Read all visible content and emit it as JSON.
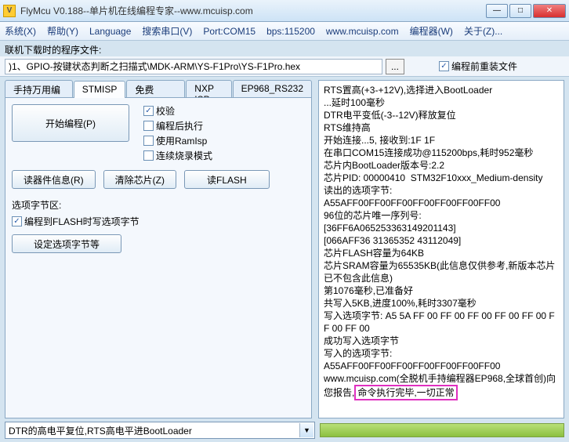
{
  "window": {
    "icon_letter": "V",
    "title": "FlyMcu V0.188--单片机在线编程专家--www.mcuisp.com"
  },
  "menu": {
    "system": "系统(X)",
    "help": "帮助(Y)",
    "language": "Language",
    "search_port": "搜索串口(V)",
    "port": "Port:COM15",
    "bps": "bps:115200",
    "site": "www.mcuisp.com",
    "programmer": "编程器(W)",
    "about": "关于(Z)..."
  },
  "toolbar": {
    "label": "联机下载时的程序文件:",
    "path": ")1、GPIO-按键状态判断之扫描式\\MDK-ARM\\YS-F1Pro\\YS-F1Pro.hex",
    "browse": "...",
    "reinstall_label": "编程前重装文件"
  },
  "tabs": {
    "t1": "手持万用编程器",
    "t2": "STMISP",
    "t3": "免费STMIAP",
    "t4": "NXP ISP",
    "t5": "EP968_RS232"
  },
  "left": {
    "start_prog": "开始编程(P)",
    "opt_verify": "校验",
    "opt_runafter": "编程后执行",
    "opt_ramisp": "使用RamIsp",
    "opt_continuous": "连续烧录模式",
    "btn_readinfo": "读器件信息(R)",
    "btn_clearchip": "清除芯片(Z)",
    "btn_readflash": "读FLASH",
    "section_label": "选项字节区:",
    "opt_writeoption": "编程到FLASH时写选项字节",
    "btn_setoption": "设定选项字节等"
  },
  "log_lines": [
    "RTS置高(+3-+12V),选择进入BootLoader",
    "...延时100毫秒",
    "DTR电平变低(-3--12V)释放复位",
    "RTS维持高",
    "开始连接...5, 接收到:1F 1F",
    "在串口COM15连接成功@115200bps,耗时952毫秒",
    "芯片内BootLoader版本号:2.2",
    "芯片PID: 00000410  STM32F10xxx_Medium-density",
    "读出的选项字节:",
    "A55AFF00FF00FF00FF00FF00FF00FF00",
    "96位的芯片唯一序列号:",
    "[36FF6A065253363149201143]",
    "[066AFF36 31365352 43112049]",
    "芯片FLASH容量为64KB",
    "芯片SRAM容量为65535KB(此信息仅供参考,新版本芯片已不包含此信息)",
    "第1076毫秒,已准备好",
    "共写入5KB,进度100%,耗时3307毫秒",
    "写入选项字节: A5 5A FF 00 FF 00 FF 00 FF 00 FF 00 FF 00 FF 00",
    "成功写入选项字节",
    "写入的选项字节:",
    "A55AFF00FF00FF00FF00FF00FF00FF00",
    "www.mcuisp.com(全脱机手持编程器EP968,全球首创)向您报告,"
  ],
  "log_highlight": "命令执行完毕,一切正常",
  "bottom": {
    "combo": "DTR的高电平复位,RTS高电平进BootLoader"
  }
}
